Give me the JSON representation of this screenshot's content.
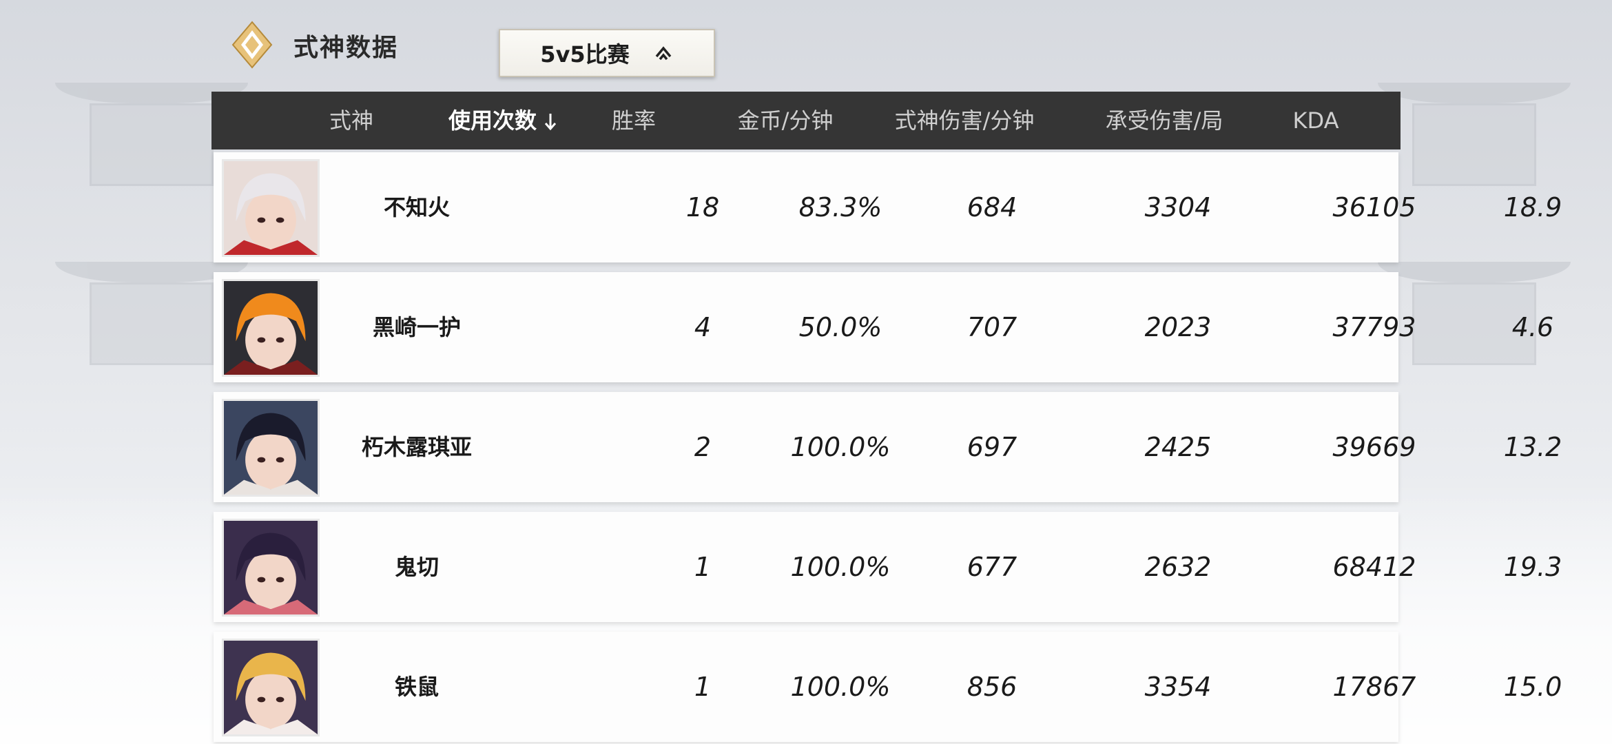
{
  "header": {
    "title": "式神数据",
    "mode_select": {
      "value": "5v5比赛"
    }
  },
  "table": {
    "columns": [
      {
        "label": "式神"
      },
      {
        "label": "使用次数",
        "sorted": true
      },
      {
        "label": "胜率"
      },
      {
        "label": "金币/分钟"
      },
      {
        "label": "式神伤害/分钟"
      },
      {
        "label": "承受伤害/局"
      },
      {
        "label": "KDA"
      }
    ],
    "rows": [
      {
        "name": "不知火",
        "uses": "18",
        "winrate": "83.3%",
        "gold": "684",
        "damage": "3304",
        "taken": "36105",
        "kda": "18.9",
        "avatar": {
          "bg": "#e8dcd8",
          "hair": "#e9e6ea",
          "accent": "#c0282c"
        }
      },
      {
        "name": "黑崎一护",
        "uses": "4",
        "winrate": "50.0%",
        "gold": "707",
        "damage": "2023",
        "taken": "37793",
        "kda": "4.6",
        "avatar": {
          "bg": "#2d2d33",
          "hair": "#f08a1c",
          "accent": "#7a1f1f"
        }
      },
      {
        "name": "朽木露琪亚",
        "uses": "2",
        "winrate": "100.0%",
        "gold": "697",
        "damage": "2425",
        "taken": "39669",
        "kda": "13.2",
        "avatar": {
          "bg": "#3b4660",
          "hair": "#1a1b2c",
          "accent": "#e9e3df"
        }
      },
      {
        "name": "鬼切",
        "uses": "1",
        "winrate": "100.0%",
        "gold": "677",
        "damage": "2632",
        "taken": "68412",
        "kda": "19.3",
        "avatar": {
          "bg": "#3a2d4c",
          "hair": "#2a1f3d",
          "accent": "#d76a78"
        }
      },
      {
        "name": "铁鼠",
        "uses": "1",
        "winrate": "100.0%",
        "gold": "856",
        "damage": "3354",
        "taken": "17867",
        "kda": "15.0",
        "avatar": {
          "bg": "#3e3350",
          "hair": "#e9b54b",
          "accent": "#f3ecea"
        }
      }
    ]
  }
}
